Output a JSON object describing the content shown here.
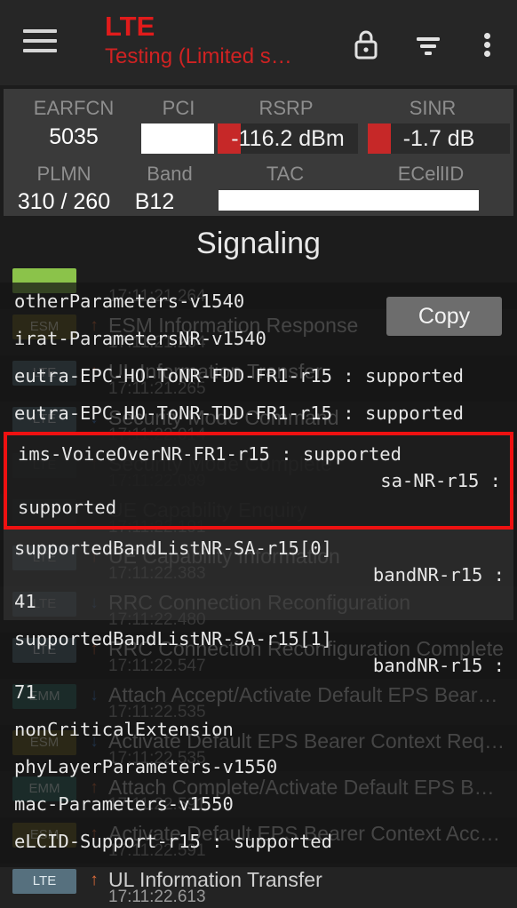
{
  "appbar": {
    "menu_icon": "hamburger-menu-icon",
    "title": "LTE",
    "subtitle": "Testing (Limited s…",
    "actions": [
      {
        "name": "lock-icon",
        "label": "Lock"
      },
      {
        "name": "filter-icon",
        "label": "Filter"
      },
      {
        "name": "overflow-menu-icon",
        "label": "More options"
      }
    ]
  },
  "status": {
    "row1": [
      {
        "label": "EARFCN",
        "value": "5035",
        "type": "text"
      },
      {
        "label": "PCI",
        "value": "",
        "type": "redacted"
      },
      {
        "label": "RSRP",
        "value": "-116.2 dBm",
        "type": "gauge",
        "bar_color": "#c62828"
      },
      {
        "label": "SINR",
        "value": "-1.7 dB",
        "type": "gauge",
        "bar_color": "#c62828"
      }
    ],
    "row2": [
      {
        "label": "PLMN",
        "value": "310 / 260",
        "type": "text"
      },
      {
        "label": "Band",
        "value": "B12",
        "type": "text"
      },
      {
        "label": "TAC",
        "value": "",
        "type": "redacted"
      },
      {
        "label": "ECellID",
        "value": "",
        "type": "redacted"
      }
    ]
  },
  "section": {
    "title": "Signaling"
  },
  "background_list": [
    {
      "badge": "",
      "badge_type": "grn",
      "dir": "",
      "message": "",
      "time": "17:11:21.264"
    },
    {
      "badge": "ESM",
      "badge_type": "esm",
      "dir": "up",
      "message": "ESM Information Response",
      "time": "17:11:21.264"
    },
    {
      "badge": "LTE",
      "badge_type": "lte",
      "dir": "up",
      "message": "UL Information Transfer",
      "time": "17:11:21.265"
    },
    {
      "badge": "LTE",
      "badge_type": "lte",
      "dir": "down",
      "message": "Security Mode Command",
      "time": "17:11:22.014"
    },
    {
      "badge": "LTE",
      "badge_type": "lte",
      "dir": "up",
      "message": "Security Mode Complete",
      "time": "17:11:22.089"
    },
    {
      "badge": "LTE",
      "badge_type": "lte",
      "dir": "down",
      "message": "UE Capability Enquiry",
      "time": "17:11:22.191"
    },
    {
      "badge": "LTE",
      "badge_type": "lte",
      "dir": "up",
      "message": "UE Capability Information",
      "time": "17:11:22.383"
    },
    {
      "badge": "LTE",
      "badge_type": "lte",
      "dir": "down",
      "message": "RRC Connection Reconfiguration",
      "time": "17:11:22.480"
    },
    {
      "badge": "LTE",
      "badge_type": "lte",
      "dir": "up",
      "message": "RRC Connection Reconfiguration Complete",
      "time": "17:11:22.547"
    },
    {
      "badge": "EMM",
      "badge_type": "emm",
      "dir": "down",
      "message": "Attach Accept/Activate Default EPS Bear…",
      "time": "17:11:22.535"
    },
    {
      "badge": "ESM",
      "badge_type": "esm",
      "dir": "down",
      "message": "Activate Default EPS Bearer Context Req…",
      "time": "17:11:22.535"
    },
    {
      "badge": "EMM",
      "badge_type": "emm",
      "dir": "up",
      "message": "Attach Complete/Activate Default EPS B…",
      "time": "17:11:22.591"
    },
    {
      "badge": "ESM",
      "badge_type": "esm",
      "dir": "up",
      "message": "Activate Default EPS Bearer Context Acc…",
      "time": "17:11:22.591"
    },
    {
      "badge": "LTE",
      "badge_type": "lte",
      "dir": "up",
      "message": "UL Information Transfer",
      "time": "17:11:22.613"
    }
  ],
  "overlay": {
    "copy_label": "Copy",
    "rows": [
      {
        "text": "otherParameters-v1540",
        "style": "plain"
      },
      {
        "text": "irat-ParametersNR-v1540",
        "style": "plain"
      },
      {
        "text": "eutra-EPC-HO-ToNR-FDD-FR1-r15 : supported",
        "style": "plain"
      },
      {
        "text": "eutra-EPC-HO-ToNR-TDD-FR1-r15 : supported",
        "style": "plain"
      },
      {
        "text": "ims-VoiceOverNR-FR1-r15 : supported",
        "text2": "sa-NR-r15 :",
        "text3": "supported",
        "style": "highlight"
      },
      {
        "text": "supportedBandListNR-SA-r15[0]",
        "text2": "bandNR-r15 :",
        "text3": "41",
        "style": "shaded"
      },
      {
        "text": "supportedBandListNR-SA-r15[1]",
        "text2": "bandNR-r15 :",
        "text3": "71",
        "style": "plain"
      },
      {
        "text": "nonCriticalExtension",
        "style": "plain"
      },
      {
        "text": "phyLayerParameters-v1550",
        "style": "plain"
      },
      {
        "text": "mac-Parameters-v1550",
        "style": "plain"
      },
      {
        "text": "eLCID-Support-r15 : supported",
        "style": "plain"
      }
    ]
  },
  "colors": {
    "accent_red": "#e01b1b",
    "highlight_red": "#ee1111",
    "app_bg": "#1c1c1c",
    "panel_bg": "#3a3a3a",
    "bar_red": "#c62828"
  }
}
